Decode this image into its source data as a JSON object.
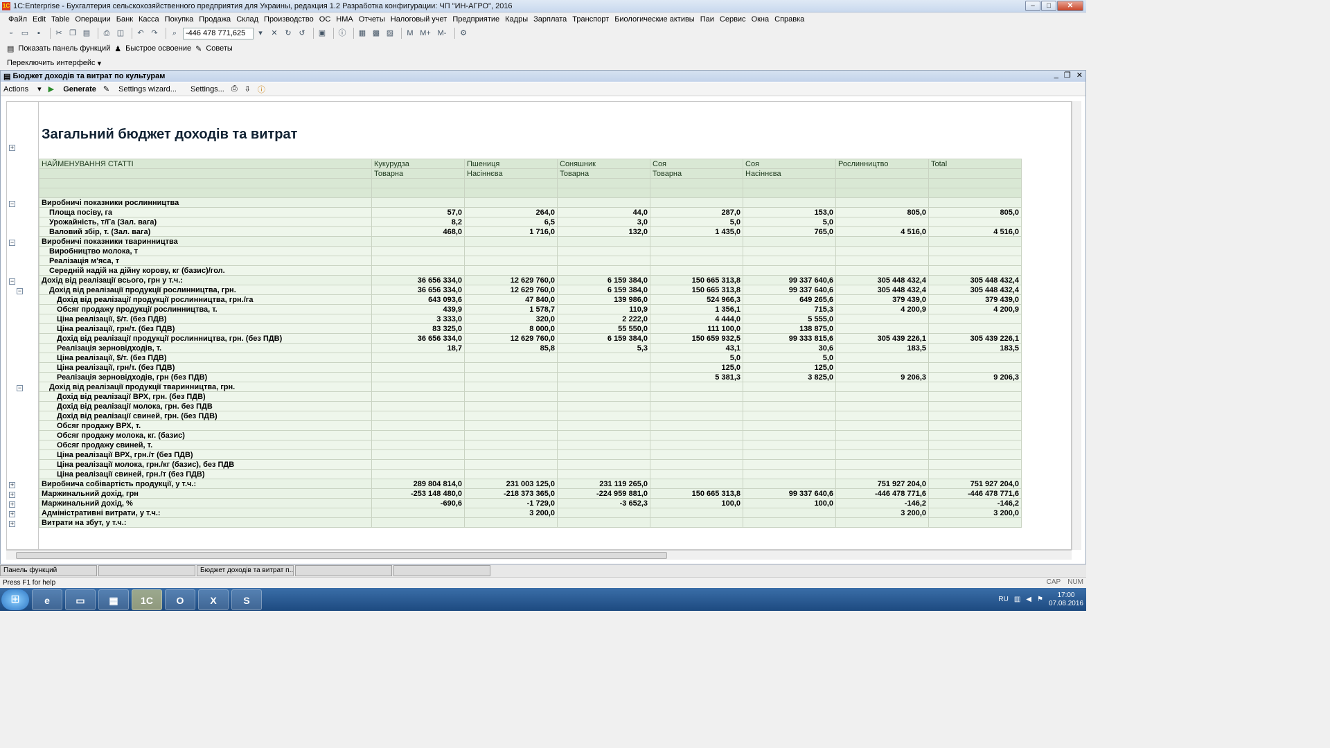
{
  "window": {
    "title": "1C:Enterprise - Бухгалтерия сельскохозяйственного предприятия для Украины, редакция 1.2 Разработка конфигурации: ЧП \"ИН-АГРО\", 2016"
  },
  "menu": [
    "Файл",
    "Edit",
    "Table",
    "Операции",
    "Банк",
    "Касса",
    "Покупка",
    "Продажа",
    "Склад",
    "Производство",
    "ОС",
    "НМА",
    "Отчеты",
    "Налоговый учет",
    "Предприятие",
    "Кадры",
    "Зарплата",
    "Транспорт",
    "Биологические активы",
    "Паи",
    "Сервис",
    "Окна",
    "Справка"
  ],
  "toolbar": {
    "calc_value": "-446 478 771,625",
    "m": "M",
    "mplus": "M+",
    "mminus": "M-"
  },
  "toolbar2": {
    "functions": "Показать панель функций",
    "quick": "Быстрое освоение",
    "tips": "Советы"
  },
  "toolbar3": {
    "switch": "Переключить интерфейс"
  },
  "doc": {
    "title": "Бюджет доходів та витрат по культурам",
    "actions": "Actions",
    "generate": "Generate",
    "wizard": "Settings wizard...",
    "settings": "Settings...",
    "report_title": "Загальний бюджет доходів та витрат",
    "header": {
      "name": "НАЙМЕНУВАННЯ СТАТТІ",
      "cols": [
        [
          "Кукурудза",
          "Товарна"
        ],
        [
          "Пшениця",
          "Насіннєва"
        ],
        [
          "Соняшник",
          "Товарна"
        ],
        [
          "Соя",
          "Товарна"
        ],
        [
          "Соя",
          "Насіннєва"
        ],
        [
          "Рослинництво",
          ""
        ],
        [
          "Total",
          ""
        ]
      ]
    },
    "rows": [
      {
        "l": "Виробничі показники рослинництва",
        "lv": 0,
        "v": [
          "",
          "",
          "",
          "",
          "",
          "",
          ""
        ]
      },
      {
        "l": "Площа посіву, га",
        "lv": 2,
        "v": [
          "57,0",
          "264,0",
          "44,0",
          "287,0",
          "153,0",
          "805,0",
          "805,0"
        ]
      },
      {
        "l": "Урожайність, т/Га (Зал. вага)",
        "lv": 2,
        "v": [
          "8,2",
          "6,5",
          "3,0",
          "5,0",
          "5,0",
          "",
          ""
        ]
      },
      {
        "l": "Валовий збір, т. (Зал. вага)",
        "lv": 2,
        "v": [
          "468,0",
          "1 716,0",
          "132,0",
          "1 435,0",
          "765,0",
          "4 516,0",
          "4 516,0"
        ]
      },
      {
        "l": "Виробничі показники тваринництва",
        "lv": 0,
        "v": [
          "",
          "",
          "",
          "",
          "",
          "",
          ""
        ]
      },
      {
        "l": "Виробництво молока, т",
        "lv": 2,
        "v": [
          "",
          "",
          "",
          "",
          "",
          "",
          ""
        ]
      },
      {
        "l": "Реалізація м'яса, т",
        "lv": 2,
        "v": [
          "",
          "",
          "",
          "",
          "",
          "",
          ""
        ]
      },
      {
        "l": "Середній надій на дійну корову, кг (базис)/гол.",
        "lv": 2,
        "v": [
          "",
          "",
          "",
          "",
          "",
          "",
          ""
        ]
      },
      {
        "l": "Дохід від реалізації всього, грн у т.ч.:",
        "lv": 0,
        "v": [
          "36 656 334,0",
          "12 629 760,0",
          "6 159 384,0",
          "150 665 313,8",
          "99 337 640,6",
          "305 448 432,4",
          "305 448 432,4"
        ]
      },
      {
        "l": "Дохід від реалізації продукції рослинництва, грн.",
        "lv": 1,
        "v": [
          "36 656 334,0",
          "12 629 760,0",
          "6 159 384,0",
          "150 665 313,8",
          "99 337 640,6",
          "305 448 432,4",
          "305 448 432,4"
        ]
      },
      {
        "l": "Дохід від реалізації продукції рослинництва, грн./га",
        "lv": 3,
        "v": [
          "643 093,6",
          "47 840,0",
          "139 986,0",
          "524 966,3",
          "649 265,6",
          "379 439,0",
          "379 439,0"
        ]
      },
      {
        "l": "Обсяг продажу продукції рослинництва, т.",
        "lv": 3,
        "v": [
          "439,9",
          "1 578,7",
          "110,9",
          "1 356,1",
          "715,3",
          "4 200,9",
          "4 200,9"
        ]
      },
      {
        "l": "Ціна реалізації, $/т. (без ПДВ)",
        "lv": 3,
        "v": [
          "3 333,0",
          "320,0",
          "2 222,0",
          "4 444,0",
          "5 555,0",
          "",
          ""
        ]
      },
      {
        "l": "Ціна реалізації, грн/т. (без ПДВ)",
        "lv": 3,
        "v": [
          "83 325,0",
          "8 000,0",
          "55 550,0",
          "111 100,0",
          "138 875,0",
          "",
          ""
        ]
      },
      {
        "l": "Дохід від реалізації продукції рослинництва, грн. (без ПДВ)",
        "lv": 3,
        "v": [
          "36 656 334,0",
          "12 629 760,0",
          "6 159 384,0",
          "150 659 932,5",
          "99 333 815,6",
          "305 439 226,1",
          "305 439 226,1"
        ]
      },
      {
        "l": "Реалізація зерновідходів, т.",
        "lv": 3,
        "v": [
          "18,7",
          "85,8",
          "5,3",
          "43,1",
          "30,6",
          "183,5",
          "183,5"
        ]
      },
      {
        "l": "Ціна реалізації, $/т. (без ПДВ)",
        "lv": 3,
        "v": [
          "",
          "",
          "",
          "5,0",
          "5,0",
          "",
          ""
        ]
      },
      {
        "l": "Ціна реалізації, грн/т. (без ПДВ)",
        "lv": 3,
        "v": [
          "",
          "",
          "",
          "125,0",
          "125,0",
          "",
          ""
        ]
      },
      {
        "l": "Реалізація зерновідходів, грн (без ПДВ)",
        "lv": 3,
        "v": [
          "",
          "",
          "",
          "5 381,3",
          "3 825,0",
          "9 206,3",
          "9 206,3"
        ]
      },
      {
        "l": "Дохід від реалізації продукції тваринництва, грн.",
        "lv": 1,
        "v": [
          "",
          "",
          "",
          "",
          "",
          "",
          ""
        ]
      },
      {
        "l": "Дохід від реалізації ВРХ, грн. (без ПДВ)",
        "lv": 3,
        "v": [
          "",
          "",
          "",
          "",
          "",
          "",
          ""
        ]
      },
      {
        "l": "Дохід від реалізації молока, грн. без ПДВ",
        "lv": 3,
        "v": [
          "",
          "",
          "",
          "",
          "",
          "",
          ""
        ]
      },
      {
        "l": "Дохід від реалізації свиней, грн. (без ПДВ)",
        "lv": 3,
        "v": [
          "",
          "",
          "",
          "",
          "",
          "",
          ""
        ]
      },
      {
        "l": "Обсяг продажу ВРХ, т.",
        "lv": 3,
        "v": [
          "",
          "",
          "",
          "",
          "",
          "",
          ""
        ]
      },
      {
        "l": "Обсяг продажу молока, кг. (базис)",
        "lv": 3,
        "v": [
          "",
          "",
          "",
          "",
          "",
          "",
          ""
        ]
      },
      {
        "l": "Обсяг продажу свиней, т.",
        "lv": 3,
        "v": [
          "",
          "",
          "",
          "",
          "",
          "",
          ""
        ]
      },
      {
        "l": "Ціна реалізації ВРХ, грн./т (без ПДВ)",
        "lv": 3,
        "v": [
          "",
          "",
          "",
          "",
          "",
          "",
          ""
        ]
      },
      {
        "l": "Ціна реалізації молока, грн./кг (базис), без ПДВ",
        "lv": 3,
        "v": [
          "",
          "",
          "",
          "",
          "",
          "",
          ""
        ]
      },
      {
        "l": "Ціна реалізації свиней, грн./т (без ПДВ)",
        "lv": 3,
        "v": [
          "",
          "",
          "",
          "",
          "",
          "",
          ""
        ]
      },
      {
        "l": "Виробнича собівартість продукції, у т.ч.:",
        "lv": 0,
        "v": [
          "289 804 814,0",
          "231 003 125,0",
          "231 119 265,0",
          "",
          "",
          "751 927 204,0",
          "751 927 204,0"
        ]
      },
      {
        "l": "Маржинальний дохід, грн",
        "lv": 0,
        "v": [
          "-253 148 480,0",
          "-218 373 365,0",
          "-224 959 881,0",
          "150 665 313,8",
          "99 337 640,6",
          "-446 478 771,6",
          "-446 478 771,6"
        ]
      },
      {
        "l": "Маржинальний дохід, %",
        "lv": 0,
        "v": [
          "-690,6",
          "-1 729,0",
          "-3 652,3",
          "100,0",
          "100,0",
          "-146,2",
          "-146,2"
        ]
      },
      {
        "l": "Адміністративні витрати, у т.ч.:",
        "lv": 0,
        "v": [
          "",
          "3 200,0",
          "",
          "",
          "",
          "3 200,0",
          "3 200,0"
        ]
      },
      {
        "l": "Витрати на збут, у т.ч.:",
        "lv": 0,
        "v": [
          "",
          "",
          "",
          "",
          "",
          "",
          ""
        ]
      }
    ]
  },
  "window_tabs": [
    "Панель функций",
    "",
    "Бюджет доходів та витрат п...",
    "",
    ""
  ],
  "status": {
    "help": "Press F1 for help",
    "cap": "CAP",
    "num": "NUM"
  },
  "taskbar": {
    "lang": "RU",
    "time": "17:00",
    "date": "07.08.2016"
  }
}
